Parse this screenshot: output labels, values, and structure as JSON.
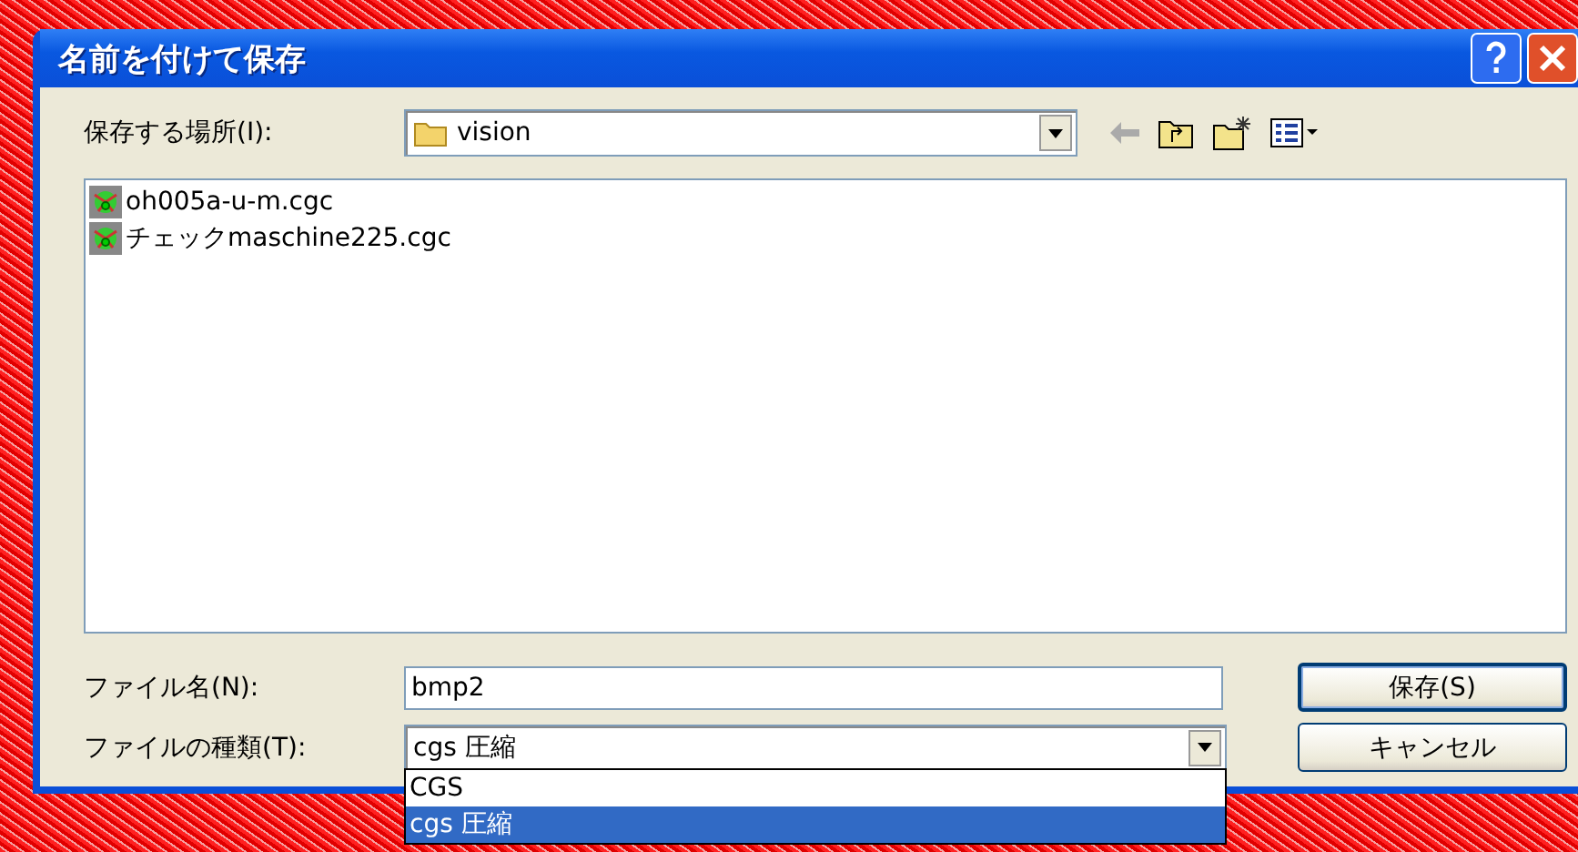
{
  "window": {
    "title": "名前を付けて保存"
  },
  "location": {
    "label": "保存する場所(I):",
    "value": "vision"
  },
  "files": [
    {
      "name": "oh005a-u-m.cgc"
    },
    {
      "name": "チェックmaschine225.cgc"
    }
  ],
  "file_name": {
    "label": "ファイル名(N):",
    "value": "bmp2"
  },
  "file_type": {
    "label": "ファイルの種類(T):",
    "value": "cgs 圧縮",
    "expanded": true,
    "options": [
      {
        "label": "CGS",
        "selected": false
      },
      {
        "label": "cgs 圧縮",
        "selected": true
      }
    ]
  },
  "buttons": [
    {
      "label": "保存(S)",
      "default": true
    },
    {
      "label": "キャンセル",
      "default": false
    }
  ]
}
